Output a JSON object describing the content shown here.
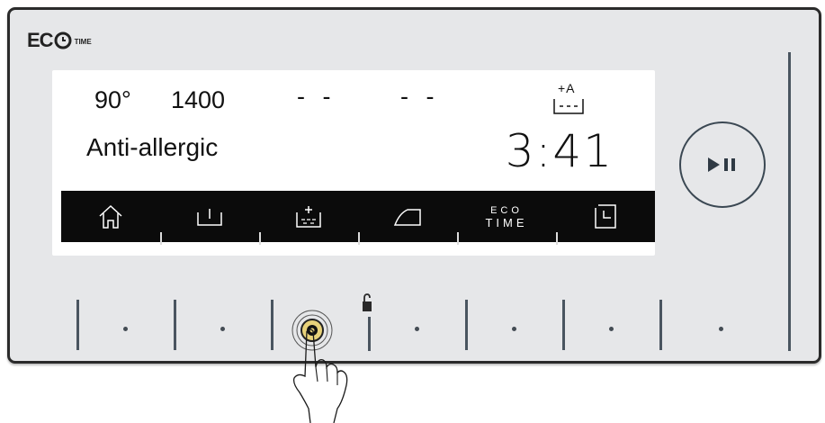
{
  "brand": {
    "eco": "EC",
    "time": "TIME"
  },
  "display": {
    "temperature": "90°",
    "spin": "1400",
    "option1": "- -",
    "option2": "- -",
    "detergent_label": "+A",
    "program": "Anti-allergic",
    "remaining_time": "3:41"
  },
  "menu": {
    "items": [
      {
        "icon": "home-icon"
      },
      {
        "icon": "tray-icon"
      },
      {
        "icon": "dosing-icon"
      },
      {
        "icon": "iron-icon"
      },
      {
        "icon": "ecotime-icon",
        "line1": "ECO",
        "line2": "TIME"
      },
      {
        "icon": "delay-timer-icon"
      }
    ]
  },
  "controls": {
    "start_pause_icon": "play-pause-icon",
    "lock_icon": "lock-icon",
    "selected_knob_icon": "selected-button-icon",
    "hand_icon": "pointing-hand-icon"
  },
  "colors": {
    "panel": "#e6e7e9",
    "bar": "#0b0b0b",
    "accent": "#3b4853"
  }
}
